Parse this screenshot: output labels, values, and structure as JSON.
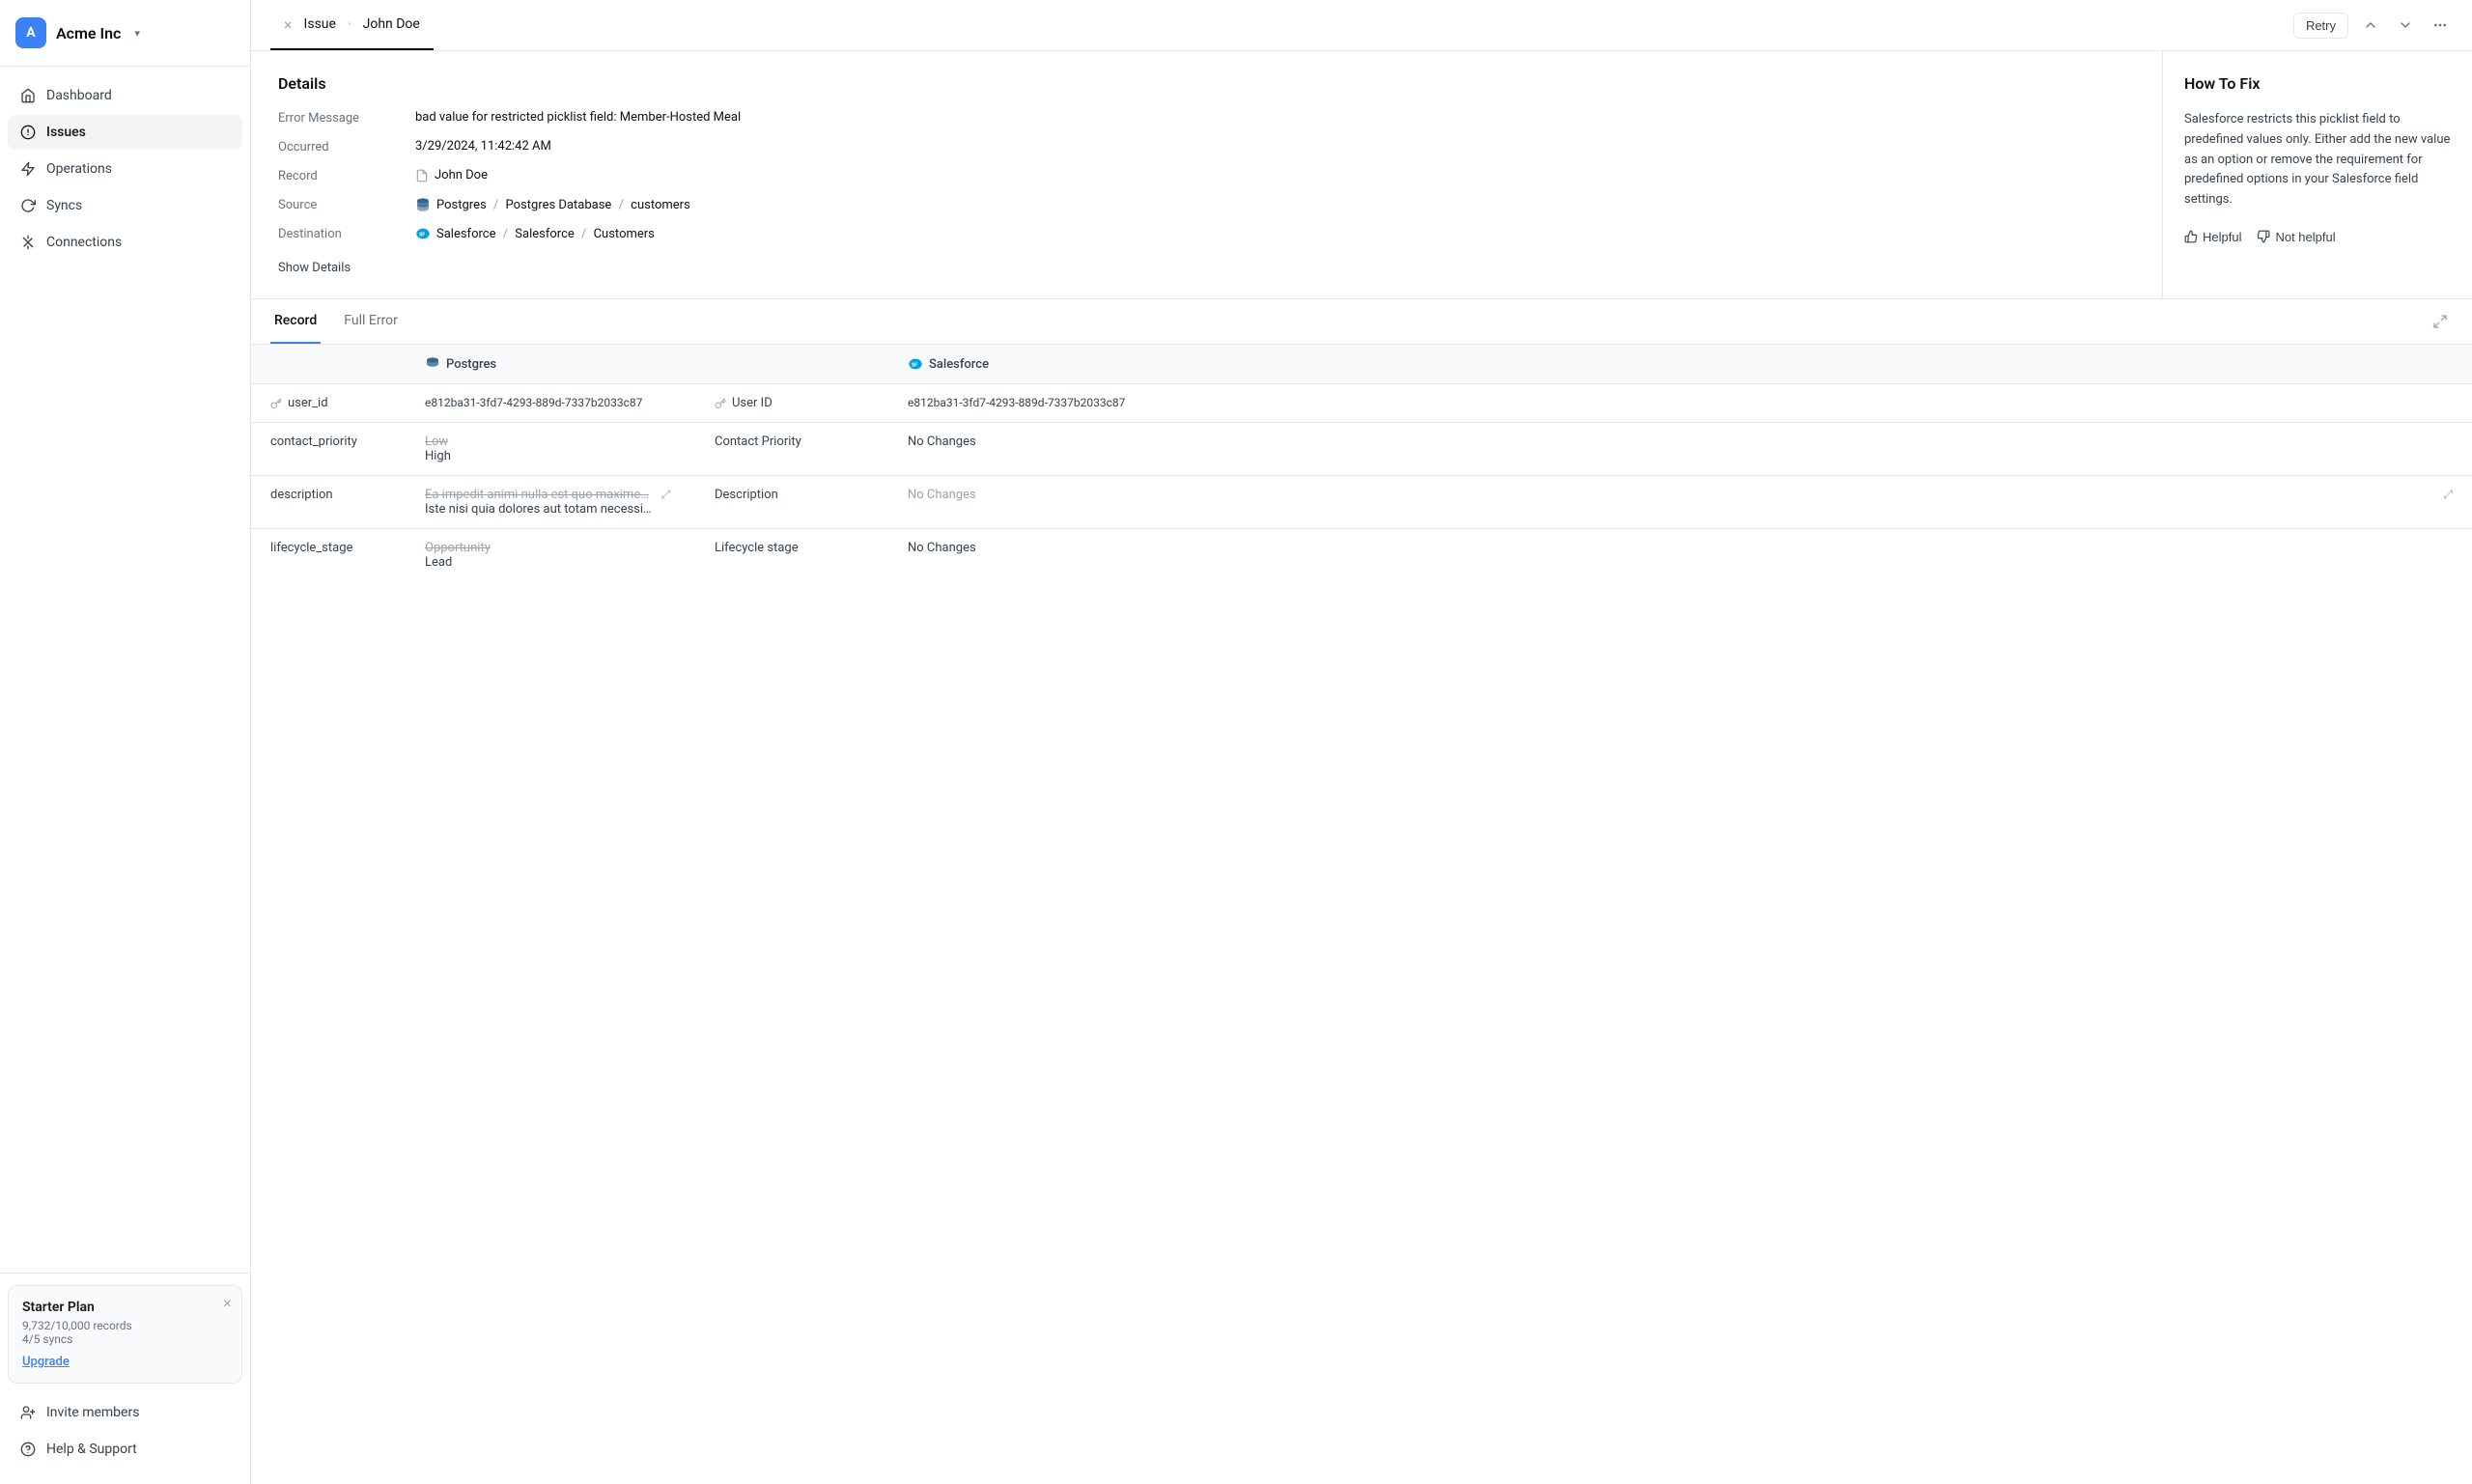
{
  "company": {
    "name": "Acme Inc",
    "logo_letter": "A"
  },
  "sidebar": {
    "nav_items": [
      {
        "id": "dashboard",
        "label": "Dashboard",
        "icon": "home",
        "active": false
      },
      {
        "id": "issues",
        "label": "Issues",
        "icon": "circle-alert",
        "active": true
      },
      {
        "id": "operations",
        "label": "Operations",
        "icon": "lightning",
        "active": false
      },
      {
        "id": "syncs",
        "label": "Syncs",
        "icon": "refresh",
        "active": false
      },
      {
        "id": "connections",
        "label": "Connections",
        "icon": "plug",
        "active": false
      }
    ],
    "plan": {
      "title": "Starter Plan",
      "records": "9,732/10,000 records",
      "syncs": "4/5 syncs",
      "upgrade_label": "Upgrade"
    },
    "bottom_items": [
      {
        "id": "invite",
        "label": "Invite members",
        "icon": "user-plus"
      },
      {
        "id": "help",
        "label": "Help & Support",
        "icon": "circle-help"
      }
    ]
  },
  "tab": {
    "close_label": "×",
    "issue_label": "Issue",
    "separator": "·",
    "user_name": "John Doe",
    "retry_btn": "Retry",
    "more_icon": "···"
  },
  "details": {
    "section_title": "Details",
    "fields": [
      {
        "label": "Error Message",
        "value": "bad value for restricted picklist field: Member-Hosted Meal",
        "type": "text"
      },
      {
        "label": "Occurred",
        "value": "3/29/2024, 11:42:42 AM",
        "type": "text"
      },
      {
        "label": "Record",
        "value": "John Doe",
        "type": "record"
      },
      {
        "label": "Source",
        "value": "Postgres / Postgres Database / customers",
        "type": "path",
        "icon": "postgres"
      },
      {
        "label": "Destination",
        "value": "Salesforce / Salesforce / Customers",
        "type": "path",
        "icon": "salesforce"
      }
    ],
    "show_details_label": "Show Details"
  },
  "how_to_fix": {
    "title": "How To Fix",
    "text": "Salesforce restricts this picklist field to predefined values only. Either add the new value as an option or remove the requirement for predefined options in your Salesforce field settings.",
    "helpful_btn": "Helpful",
    "not_helpful_btn": "Not helpful"
  },
  "record_tabs": [
    {
      "id": "record",
      "label": "Record",
      "active": true
    },
    {
      "id": "full-error",
      "label": "Full Error",
      "active": false
    }
  ],
  "record_table": {
    "pg_header": "Postgres",
    "sf_header": "Salesforce",
    "rows": [
      {
        "field": "user_id",
        "pg_value": "e812ba31-3fd7-4293-889d-7337b2033c87",
        "pg_old": null,
        "sf_field": "User ID",
        "sf_value": "e812ba31-3fd7-4293-889d-7337b2033c87",
        "is_key": true
      },
      {
        "field": "contact_priority",
        "pg_value": "High",
        "pg_old": "Low",
        "sf_field": "Contact Priority",
        "sf_value": "No Changes",
        "is_key": false,
        "no_changes": true
      },
      {
        "field": "description",
        "pg_value": "Iste nisi quia dolores aut totam necessi…",
        "pg_old": "Ea impedit animi nulla est quo maxime…",
        "sf_field": "Description",
        "sf_value": "No Changes",
        "is_key": false,
        "no_changes": true,
        "expandable": true
      },
      {
        "field": "lifecycle_stage",
        "pg_value": "Lead",
        "pg_old": "Opportunity",
        "sf_field": "Lifecycle stage",
        "sf_value": "No Changes",
        "is_key": false,
        "no_changes": true
      }
    ]
  }
}
